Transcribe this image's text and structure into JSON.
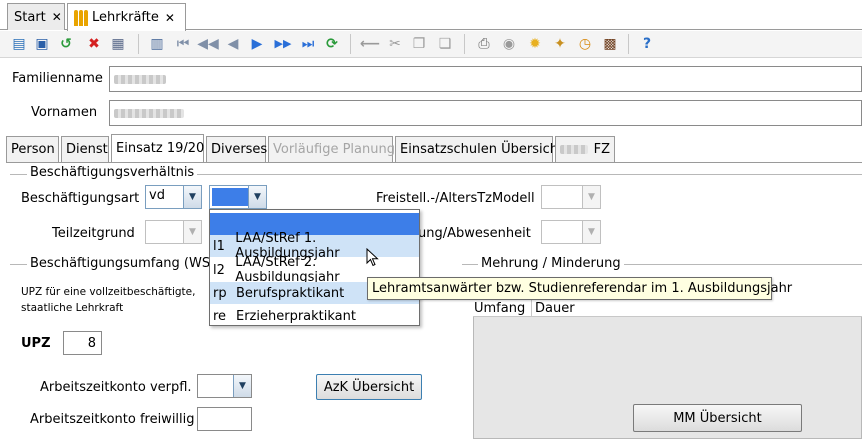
{
  "window_tabs": [
    {
      "label": "Start",
      "close": "✕"
    },
    {
      "label": "Lehrkräfte",
      "close": "✕"
    }
  ],
  "toolbar": {
    "icons": [
      "new-icon",
      "save-icon",
      "undo-icon",
      "delete-icon",
      "print-preview-icon",
      "form-icon",
      "first-icon",
      "previous-fast-icon",
      "previous-icon",
      "next-icon",
      "next-fast-icon",
      "last-icon",
      "refresh-icon",
      "back-icon",
      "cut-icon",
      "copy-icon",
      "paste-icon",
      "print-icon",
      "disk-icon",
      "idea-icon",
      "wand-icon",
      "clock-icon",
      "person-list-icon",
      "help-icon"
    ]
  },
  "header": {
    "familienname_label": "Familienname",
    "vornamen_label": "Vornamen"
  },
  "content_tabs": [
    {
      "label": "Person",
      "state": "normal"
    },
    {
      "label": "Dienst",
      "state": "normal"
    },
    {
      "label": "Einsatz 19/20",
      "state": "active"
    },
    {
      "label": "Diverses",
      "state": "normal"
    },
    {
      "label": "Vorläufige Planung",
      "state": "disabled"
    },
    {
      "label": "Einsatzschulen Übersicht",
      "state": "normal"
    },
    {
      "label": "FZ",
      "state": "normal"
    }
  ],
  "sections": {
    "beschaeftigungsverhaeltnis": "Beschäftigungsverhältnis",
    "beschaeftigungsumfang": "Beschäftigungsumfang (WStd",
    "mehrung": "Mehrung / Minderung"
  },
  "form": {
    "beschaeftigungsart_label": "Beschäftigungsart",
    "beschaeftigungsart_value": "vd",
    "teilzeitgrund_label": "Teilzeitgrund",
    "freistell_label": "Freistell.-/AltersTzModell",
    "abwesenheit_label": "ung/Abwesenheit",
    "upz_note_line1": "UPZ für eine vollzeitbeschäftigte,",
    "upz_note_line2": "staatliche Lehrkraft",
    "upz_label": "UPZ",
    "upz_value": "8",
    "azk_verpfl_label": "Arbeitszeitkonto verpfl.",
    "azk_freiwillig_label": "Arbeitszeitkonto freiwillig",
    "azk_button": "AzK Übersicht",
    "mm_button": "MM Übersicht"
  },
  "dropdown": {
    "items": [
      {
        "code": "",
        "label": ""
      },
      {
        "code": "l1",
        "label": "LAA/StRef 1. Ausbildungsjahr"
      },
      {
        "code": "l2",
        "label": "LAA/StRef 2. Ausbildungsjahr"
      },
      {
        "code": "rp",
        "label": "Berufspraktikant"
      },
      {
        "code": "re",
        "label": "Erzieherpraktikant"
      }
    ]
  },
  "tooltip": "Lehramtsanwärter bzw. Studienreferendar im 1. Ausbildungsjahr",
  "grid": {
    "columns": [
      "Umfang",
      "Dauer"
    ]
  },
  "colors": {
    "selection": "#3d7ee8",
    "hover": "#cfe3f7",
    "tooltip_bg": "#ffffe1"
  }
}
